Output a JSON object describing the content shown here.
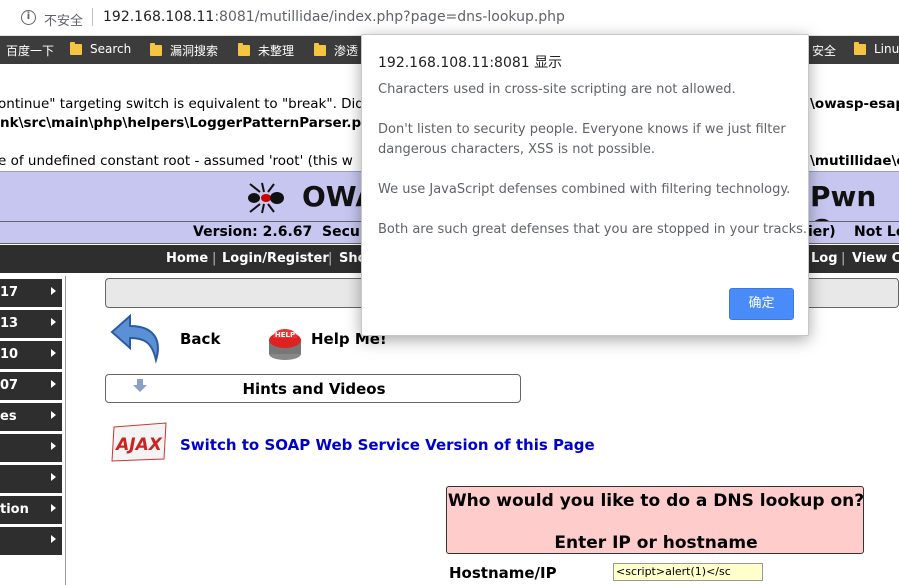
{
  "browser": {
    "security_label": "不安全",
    "url_host": "192.168.108.11",
    "url_rest": ":8081/mutillidae/index.php?page=dns-lookup.php"
  },
  "bookmarks": {
    "items": [
      "百度一下",
      "Search",
      "漏洞搜索",
      "未整理",
      "渗透",
      "安全",
      "Linu"
    ]
  },
  "errors": {
    "line1_left": "ontinue\" targeting switch is equivalent to \"break\". Did",
    "line1_right": "\\owasp-esap",
    "line2_left": "nk\\src\\main\\php\\helpers\\LoggerPatternParser.php",
    "line3_left": "e of undefined constant root - assumed 'root' (this w",
    "line3_right": "\\mutillidae\\c"
  },
  "banner": {
    "title_left": "OWA",
    "title_right": "Pwn Or"
  },
  "version_bar": {
    "version": "Version: 2.6.67",
    "security": "Secur",
    "security_tail": "ier)",
    "not_logged": "Not Lo"
  },
  "nav": {
    "home": "Home",
    "login": "Login/Register",
    "show": "Sho",
    "log": "Log",
    "view": "View Co"
  },
  "sidebar": {
    "items": [
      "17",
      "13",
      "10",
      "07",
      "es",
      "",
      "",
      "tion",
      ""
    ]
  },
  "content": {
    "back_label": "Back",
    "help_label": "Help Me!",
    "hints_label": "Hints and Videos",
    "soap_link": "Switch to SOAP Web Service Version of this Page",
    "ajax_logo_text": "AJAX",
    "help_icon_text": "HELP",
    "dns_question": "Who would you like to do a DNS lookup on?",
    "dns_enter": "Enter IP or hostname",
    "hostname_label": "Hostname/IP",
    "hostname_value": "<script>alert(1)</sc"
  },
  "dialog": {
    "title": "192.168.108.11:8081 显示",
    "messages": [
      "Characters used in cross-site scripting are not allowed.",
      "Don't listen to security people. Everyone knows if we just filter",
      "dangerous characters, XSS is not possible.",
      "We use JavaScript defenses combined with filtering technology.",
      "Both are such great defenses that you are stopped in your tracks."
    ],
    "ok_label": "确定"
  },
  "colors": {
    "banner_bg": "#c6c6f0",
    "nav_bg": "#2e2e2e",
    "dns_box_bg": "#ffcccc",
    "input_bg": "#ffffcc",
    "link": "#0000cc",
    "dialog_button": "#4a8cf7"
  }
}
